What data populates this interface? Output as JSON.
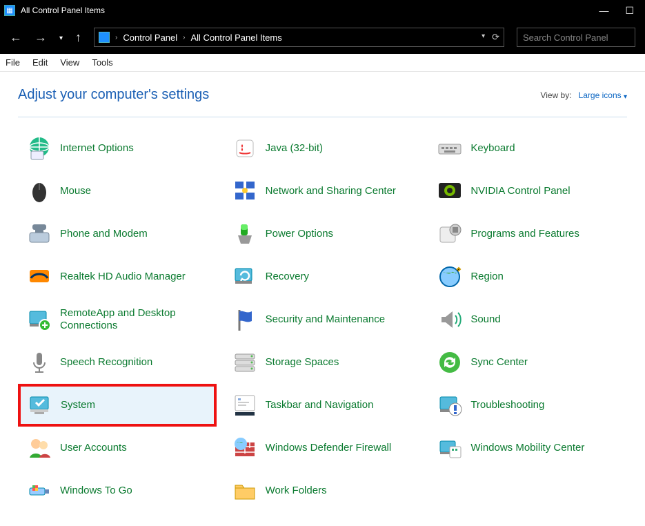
{
  "window": {
    "title": "All Control Panel Items"
  },
  "nav": {
    "breadcrumb": [
      "Control Panel",
      "All Control Panel Items"
    ],
    "search_placeholder": "Search Control Panel"
  },
  "menu": {
    "items": [
      "File",
      "Edit",
      "View",
      "Tools"
    ]
  },
  "heading": "Adjust your computer's settings",
  "viewby": {
    "label": "View by:",
    "value": "Large icons"
  },
  "items": [
    {
      "label": "Internet Options",
      "icon": "globe",
      "highlight": false
    },
    {
      "label": "Java (32-bit)",
      "icon": "java",
      "highlight": false
    },
    {
      "label": "Keyboard",
      "icon": "keyboard",
      "highlight": false
    },
    {
      "label": "Mouse",
      "icon": "mouse",
      "highlight": false
    },
    {
      "label": "Network and Sharing Center",
      "icon": "network",
      "highlight": false
    },
    {
      "label": "NVIDIA Control Panel",
      "icon": "nvidia",
      "highlight": false
    },
    {
      "label": "Phone and Modem",
      "icon": "phone",
      "highlight": false
    },
    {
      "label": "Power Options",
      "icon": "power",
      "highlight": false
    },
    {
      "label": "Programs and Features",
      "icon": "programs",
      "highlight": false
    },
    {
      "label": "Realtek HD Audio Manager",
      "icon": "realtek",
      "highlight": false
    },
    {
      "label": "Recovery",
      "icon": "recovery",
      "highlight": false
    },
    {
      "label": "Region",
      "icon": "region",
      "highlight": false
    },
    {
      "label": "RemoteApp and Desktop Connections",
      "icon": "remote",
      "highlight": false
    },
    {
      "label": "Security and Maintenance",
      "icon": "flag",
      "highlight": false
    },
    {
      "label": "Sound",
      "icon": "sound",
      "highlight": false
    },
    {
      "label": "Speech Recognition",
      "icon": "speech",
      "highlight": false
    },
    {
      "label": "Storage Spaces",
      "icon": "storage",
      "highlight": false
    },
    {
      "label": "Sync Center",
      "icon": "sync",
      "highlight": false
    },
    {
      "label": "System",
      "icon": "system",
      "highlight": true
    },
    {
      "label": "Taskbar and Navigation",
      "icon": "taskbar",
      "highlight": false
    },
    {
      "label": "Troubleshooting",
      "icon": "trouble",
      "highlight": false
    },
    {
      "label": "User Accounts",
      "icon": "users",
      "highlight": false
    },
    {
      "label": "Windows Defender Firewall",
      "icon": "firewall",
      "highlight": false
    },
    {
      "label": "Windows Mobility Center",
      "icon": "mobility",
      "highlight": false
    },
    {
      "label": "Windows To Go",
      "icon": "togo",
      "highlight": false
    },
    {
      "label": "Work Folders",
      "icon": "folders",
      "highlight": false
    }
  ]
}
